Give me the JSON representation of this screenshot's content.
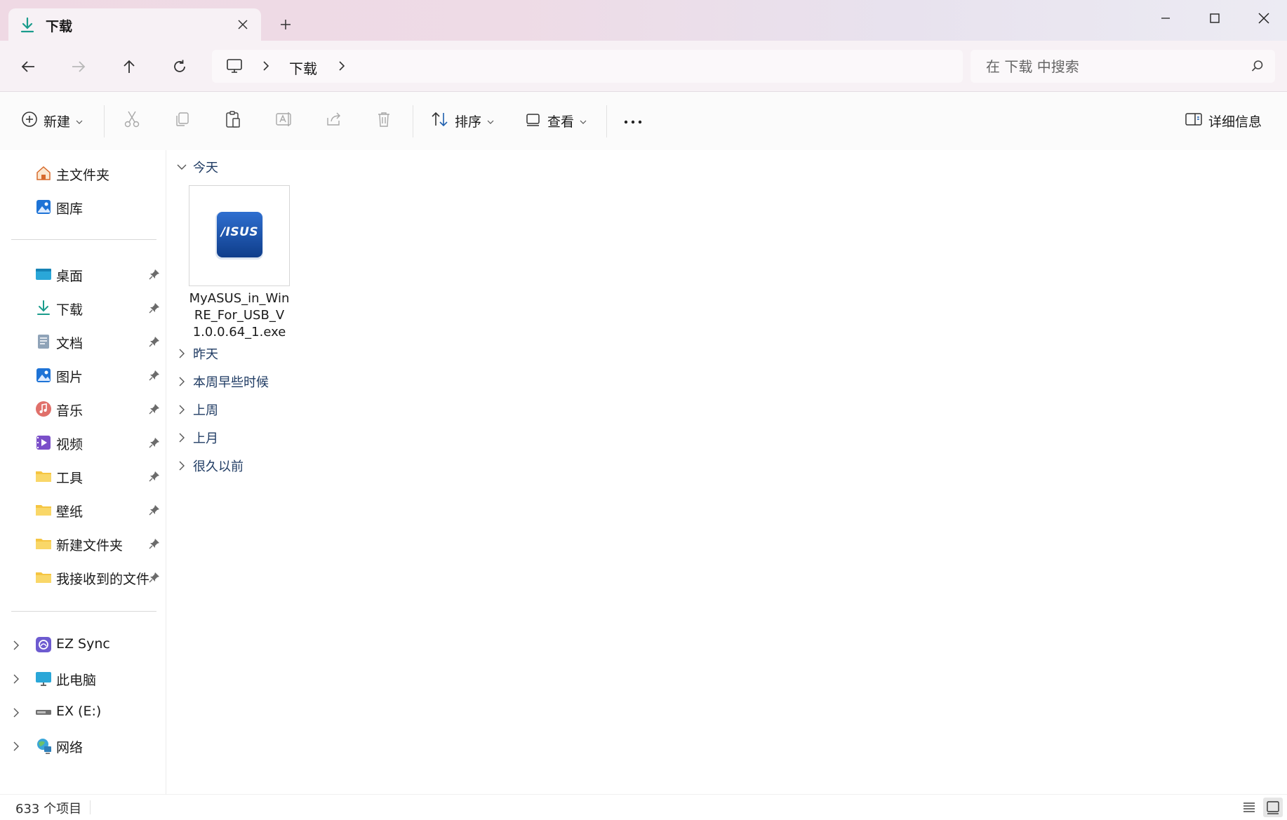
{
  "tab": {
    "title": "下载"
  },
  "address": {
    "current_folder": "下载"
  },
  "search": {
    "placeholder": "在 下载 中搜索"
  },
  "toolbar": {
    "new_label": "新建",
    "sort_label": "排序",
    "view_label": "查看",
    "details_label": "详细信息"
  },
  "sidebar": {
    "top": [
      {
        "label": "主文件夹",
        "icon": "home-icon"
      },
      {
        "label": "图库",
        "icon": "gallery-icon"
      }
    ],
    "pinned": [
      {
        "label": "桌面",
        "icon": "desktop-folder-icon"
      },
      {
        "label": "下载",
        "icon": "download-folder-icon"
      },
      {
        "label": "文档",
        "icon": "documents-folder-icon"
      },
      {
        "label": "图片",
        "icon": "pictures-folder-icon"
      },
      {
        "label": "音乐",
        "icon": "music-folder-icon"
      },
      {
        "label": "视频",
        "icon": "videos-folder-icon"
      },
      {
        "label": "工具",
        "icon": "folder-icon"
      },
      {
        "label": "壁纸",
        "icon": "folder-icon"
      },
      {
        "label": "新建文件夹",
        "icon": "folder-icon"
      },
      {
        "label": "我接收到的文件",
        "icon": "folder-icon"
      }
    ],
    "locations": [
      {
        "label": "EZ Sync",
        "icon": "ez-sync-icon"
      },
      {
        "label": "此电脑",
        "icon": "this-pc-icon"
      },
      {
        "label": "EX (E:)",
        "icon": "drive-icon"
      },
      {
        "label": "网络",
        "icon": "network-icon"
      }
    ]
  },
  "groups": {
    "today": "今天",
    "yesterday": "昨天",
    "earlier_this_week": "本周早些时候",
    "last_week": "上周",
    "last_month": "上月",
    "long_ago": "很久以前"
  },
  "files": [
    {
      "name": "MyASUS_in_WinRE_For_USB_V1.0.0.64_1.exe",
      "thumb_text": "/ISUS",
      "icon": "asus-app-icon"
    }
  ],
  "status": {
    "item_count": "633 个项目"
  },
  "colors": {
    "accent": "#1f5fae",
    "group_text": "#1f3b63",
    "folder": "#f5c542"
  }
}
